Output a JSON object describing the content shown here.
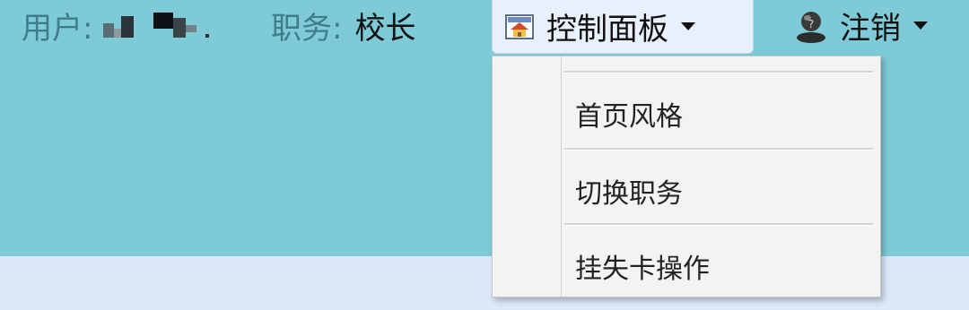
{
  "header": {
    "user_label": "用户:",
    "role_label": "职务:",
    "role_value": "校长",
    "control_panel": {
      "label": "控制面板",
      "icon": "home-window-icon"
    },
    "logout": {
      "label": "注销",
      "icon": "user-avatar-icon"
    }
  },
  "dropdown": {
    "items": [
      {
        "label": "首页风格"
      },
      {
        "label": "切换职务"
      },
      {
        "label": "挂失卡操作"
      }
    ]
  },
  "colors": {
    "topbar_bg": "#7ecad6",
    "page_bg": "#dde9fa",
    "menu_bg": "#f3f3f3"
  }
}
